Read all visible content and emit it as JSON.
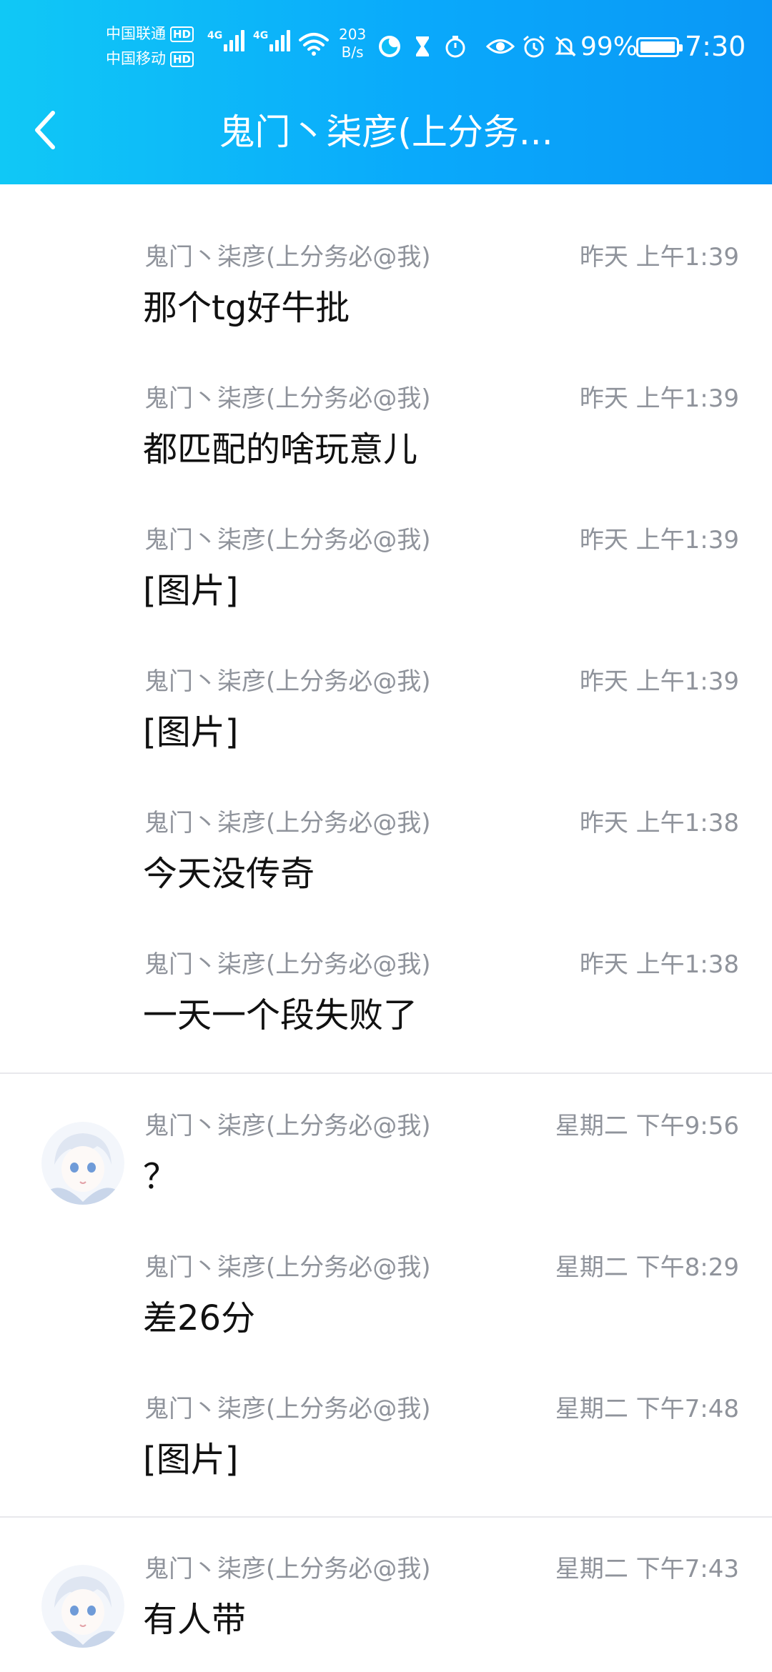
{
  "status_bar": {
    "carrier1": "中国联通",
    "carrier2": "中国移动",
    "hd_label": "HD",
    "net_tag": "4G",
    "speed_value": "203",
    "speed_unit": "B/s",
    "battery": "99%",
    "time": "7:30"
  },
  "header": {
    "title": "鬼门丶柒彦(上分务..."
  },
  "messages": [
    {
      "sender": "鬼门丶柒彦(上分务必@我)",
      "time": "昨天 上午1:39",
      "text": "那个tg好牛批"
    },
    {
      "sender": "鬼门丶柒彦(上分务必@我)",
      "time": "昨天 上午1:39",
      "text": "都匹配的啥玩意儿"
    },
    {
      "sender": "鬼门丶柒彦(上分务必@我)",
      "time": "昨天 上午1:39",
      "text": "[图片]"
    },
    {
      "sender": "鬼门丶柒彦(上分务必@我)",
      "time": "昨天 上午1:39",
      "text": "[图片]"
    },
    {
      "sender": "鬼门丶柒彦(上分务必@我)",
      "time": "昨天 上午1:38",
      "text": "今天没传奇"
    },
    {
      "sender": "鬼门丶柒彦(上分务必@我)",
      "time": "昨天 上午1:38",
      "text": "一天一个段失败了"
    },
    {
      "sender": "鬼门丶柒彦(上分务必@我)",
      "time": "星期二 下午9:56",
      "text": "？"
    },
    {
      "sender": "鬼门丶柒彦(上分务必@我)",
      "time": "星期二 下午8:29",
      "text": "差26分"
    },
    {
      "sender": "鬼门丶柒彦(上分务必@我)",
      "time": "星期二 下午7:48",
      "text": "[图片]"
    },
    {
      "sender": "鬼门丶柒彦(上分务必@我)",
      "time": "星期二 下午7:43",
      "text": "有人带"
    }
  ],
  "colors": {
    "header_gradient_start": "#10c8f6",
    "header_gradient_end": "#0a97f6",
    "meta_text": "#8f939b",
    "body_text": "#111111",
    "divider": "#e8e8ec"
  }
}
